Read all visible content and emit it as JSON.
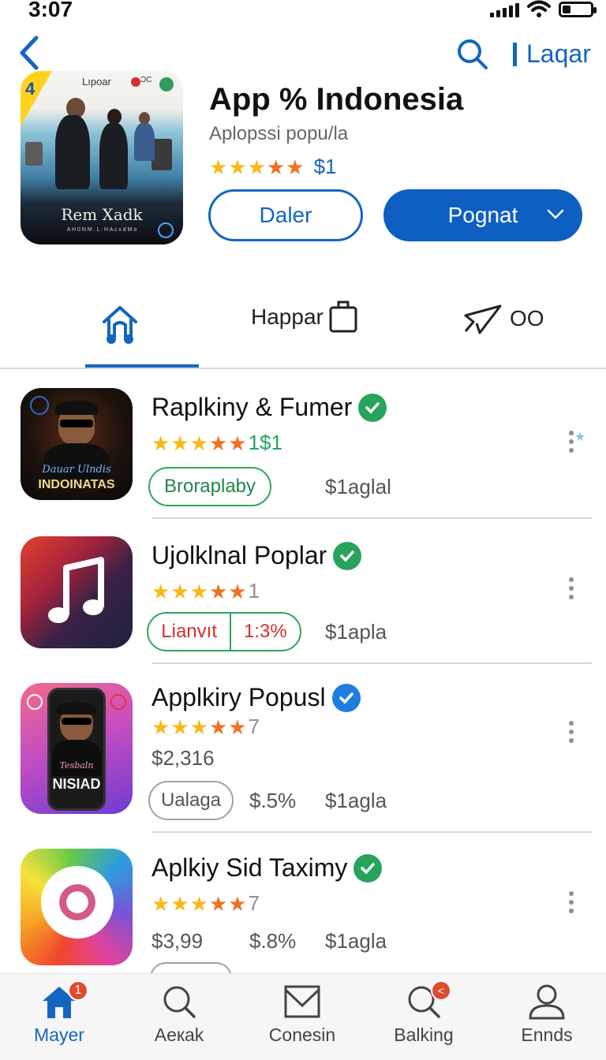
{
  "status_bar": {
    "time": "3:07",
    "battery_level": 0.3
  },
  "header": {
    "right_link": "Laqar"
  },
  "hero": {
    "title": "App % Indonesia",
    "subtitle": "Aplopssi popu/la",
    "rating": 4.5,
    "price": "$1",
    "secondary_button": "Daler",
    "primary_button": "Pognat",
    "art": {
      "corner_number": "4",
      "brand": "Lıpoar",
      "corner_text": "ƆC",
      "title": "Rem Xadk",
      "subtitle": "A   H 0 N M . L : H   A c x d M o",
      "ribbon_color": "#ffd21f"
    }
  },
  "tabs": {
    "items": [
      {
        "name": "home",
        "label": ""
      },
      {
        "name": "happar",
        "label": "Happar"
      },
      {
        "name": "share",
        "label": "OO"
      }
    ],
    "active_index": 0
  },
  "list": [
    {
      "name": "Raplkiny & Fumer",
      "verified_color": "#28a35e",
      "rating": 4.5,
      "rating_suffix": "1$1",
      "pill": "Broraplaby",
      "meta": [
        "$1aglal"
      ],
      "thumb_caption": "INDOINATAS",
      "thumb_script": "Dauar Ulndis"
    },
    {
      "name": "Ujolklnal Poplar",
      "verified_color": "#28a35e",
      "rating": 4.5,
      "rating_suffix": "1",
      "pill_left": "Lianvıt",
      "pill_right": "1:3%",
      "meta": [
        "$1apla"
      ]
    },
    {
      "name": "Applkiry Popusl",
      "verified_color": "#1e7ee0",
      "rating": 4.5,
      "rating_suffix": "7",
      "price": "$2,316",
      "pill": "Ualaga",
      "meta": [
        "$.5%",
        "$1agla"
      ],
      "thumb_caption": "NISIAD",
      "thumb_script": "Tesbaln"
    },
    {
      "name": "Aplkiy Sid Taximy",
      "verified_color": "#28a35e",
      "rating": 4.5,
      "rating_suffix": "7",
      "meta": [
        "$3,99",
        "$.8%",
        "$1agla"
      ]
    }
  ],
  "bottom_nav": {
    "items": [
      {
        "name": "home",
        "label": "Mayer",
        "badge": "1"
      },
      {
        "name": "search",
        "label": "Aекak"
      },
      {
        "name": "mail",
        "label": "Conesin"
      },
      {
        "name": "search-alert",
        "label": "Balking"
      },
      {
        "name": "profile",
        "label": "Ennds"
      }
    ],
    "active_index": 0
  },
  "colors": {
    "accent": "#1565c0",
    "verified_green": "#28a35e",
    "star": "#f8b914"
  }
}
